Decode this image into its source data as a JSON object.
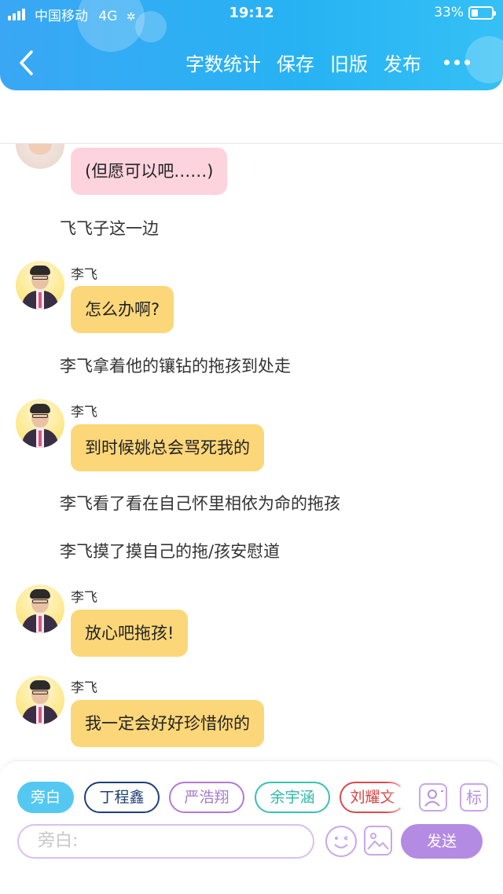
{
  "status_bar": {
    "carrier": "中国移动",
    "network": "4G",
    "time": "19:12",
    "battery": "33%",
    "battery_level": 0.33
  },
  "header": {
    "back_icon": "chevron-left-icon",
    "actions": [
      "字数统计",
      "保存",
      "旧版",
      "发布"
    ],
    "more_icon": "more-dots-icon",
    "background_color": "#2fb0f4"
  },
  "messages": [
    {
      "type": "bubble",
      "speaker": "",
      "text": "(但愿可以吧……)",
      "style": "pink",
      "avatar": "girl-avatar"
    },
    {
      "type": "narration",
      "text": "飞飞子这一边"
    },
    {
      "type": "bubble",
      "speaker": "李飞",
      "text": "怎么办啊?",
      "style": "yellow",
      "avatar": "lifei-avatar"
    },
    {
      "type": "narration",
      "text": "李飞拿着他的镶钻的拖孩到处走"
    },
    {
      "type": "bubble",
      "speaker": "李飞",
      "text": "到时候姚总会骂死我的",
      "style": "yellow",
      "avatar": "lifei-avatar"
    },
    {
      "type": "narration",
      "text": "李飞看了看在自己怀里相依为命的拖孩"
    },
    {
      "type": "narration",
      "text": "李飞摸了摸自己的拖/孩安慰道"
    },
    {
      "type": "bubble",
      "speaker": "李飞",
      "text": "放心吧拖孩!",
      "style": "yellow",
      "avatar": "lifei-avatar"
    },
    {
      "type": "bubble",
      "speaker": "李飞",
      "text": "我一定会好好珍惜你的",
      "style": "yellow",
      "avatar": "lifei-avatar"
    }
  ],
  "composer": {
    "roles": [
      "旁白",
      "丁程鑫",
      "严浩翔",
      "余宇涵",
      "刘耀文"
    ],
    "selected_role": "旁白",
    "role_icon": "character-card-icon",
    "tag_label": "标",
    "input_placeholder": "旁白:",
    "emoji_icon": "emoji-icon",
    "image_icon": "image-icon",
    "send_label": "发送",
    "accent_color": "#b48be3"
  }
}
